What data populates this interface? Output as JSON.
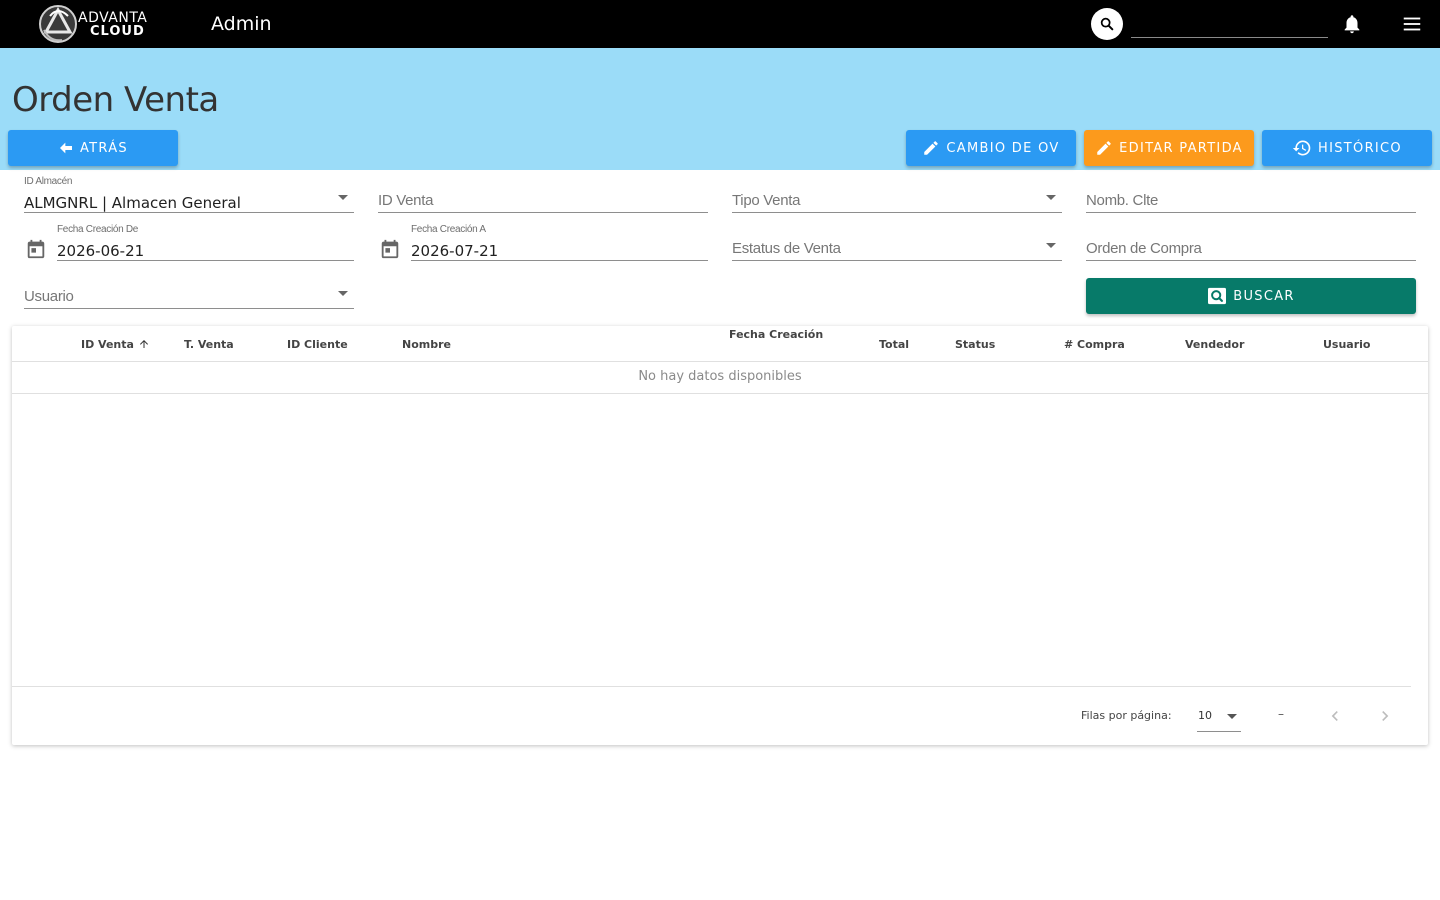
{
  "topbar": {
    "logo_line1": "ADVANTA",
    "logo_line2": "CLOUD",
    "title": "Admin",
    "search_value": ""
  },
  "page": {
    "title": "Orden Venta"
  },
  "actions": {
    "back_label": "ATRÁS",
    "cambio_label": "CAMBIO DE OV",
    "editar_label": "EDITAR PARTIDA",
    "historico_label": "HISTÓRICO",
    "buscar_label": "BUSCAR"
  },
  "filters": {
    "almacen": {
      "label": "ID Almacén",
      "value": "ALMGNRL | Almacen General"
    },
    "id_venta": {
      "placeholder": "ID Venta"
    },
    "tipo_venta": {
      "placeholder": "Tipo Venta"
    },
    "nomb_clte": {
      "placeholder": "Nomb. Clte"
    },
    "fecha_de": {
      "label": "Fecha Creación De",
      "value": "2026-06-21"
    },
    "fecha_a": {
      "label": "Fecha Creación A",
      "value": "2026-07-21"
    },
    "estatus": {
      "placeholder": "Estatus de Venta"
    },
    "orden_compra": {
      "placeholder": "Orden de Compra"
    },
    "usuario": {
      "placeholder": "Usuario"
    }
  },
  "table": {
    "columns": [
      "ID Venta",
      "T. Venta",
      "ID Cliente",
      "Nombre",
      "Fecha Creación",
      "Total",
      "Status",
      "# Compra",
      "Vendedor",
      "Usuario"
    ],
    "empty_message": "No hay datos disponibles",
    "footer": {
      "rows_per_page_label": "Filas por página:",
      "rows_per_page_value": "10",
      "range": "–"
    }
  },
  "colors": {
    "topbar": "#000000",
    "band": "#9bdcf8",
    "primary": "#2b9af3",
    "warning": "#fc9a1c",
    "teal": "#077a69"
  }
}
